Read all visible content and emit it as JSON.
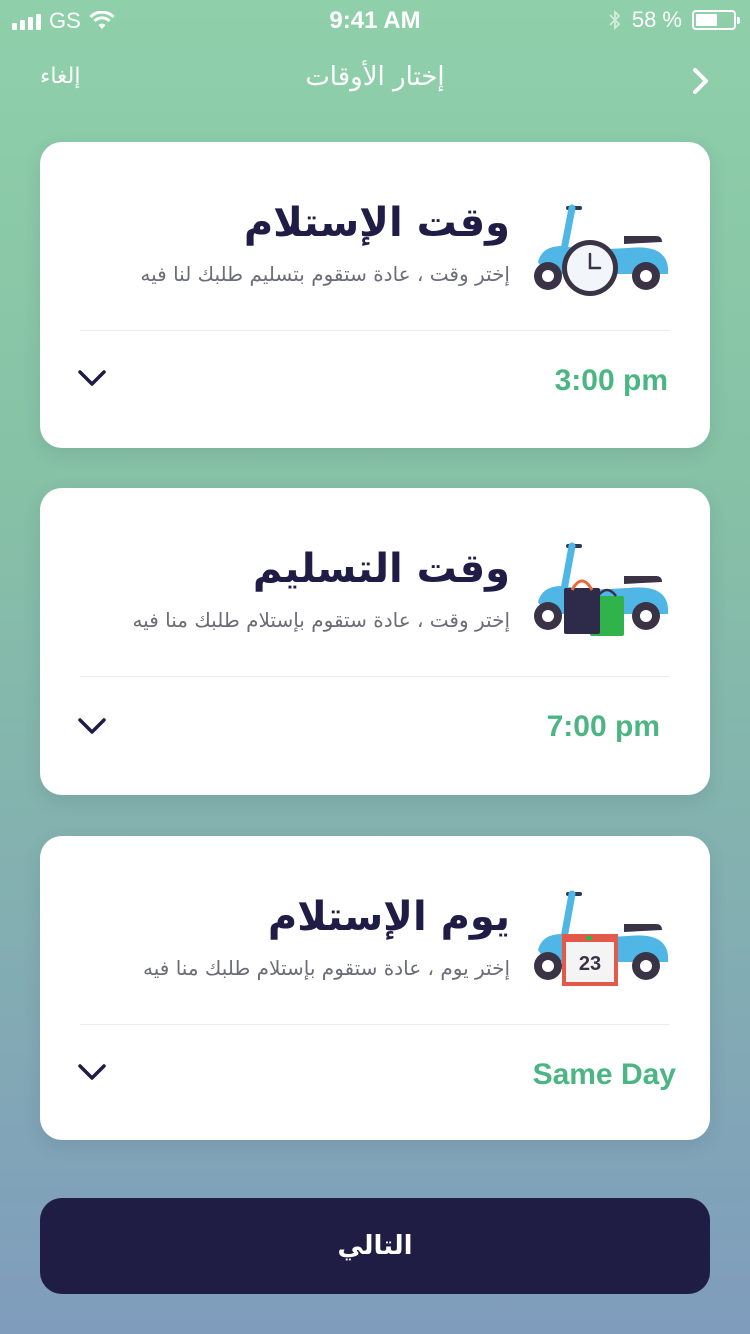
{
  "status_bar": {
    "carrier": "GS",
    "time": "9:41 AM",
    "battery": "58 %",
    "battery_level": 0.58
  },
  "nav": {
    "cancel_label": "إلغاء",
    "title": "إختار الأوقات",
    "back_icon": "chevron-right-icon"
  },
  "cards": [
    {
      "title": "وقت الإستلام",
      "subtitle": "إختر وقت ، عادة ستقوم بتسليم طلبك لنا فيه",
      "value": "3:00 pm",
      "illustration": "scooter-clock-illustration"
    },
    {
      "title": "وقت التسليم",
      "subtitle": "إختر وقت ، عادة ستقوم بإستلام طلبك منا فيه",
      "value": "7:00 pm",
      "illustration": "scooter-bags-illustration"
    },
    {
      "title": "يوم الإستلام",
      "subtitle": "إختر يوم ، عادة ستقوم بإستلام طلبك منا فيه",
      "value": "Same Day",
      "illustration": "scooter-calendar-illustration",
      "calendar_day": "23"
    }
  ],
  "next_button": {
    "label": "التالي"
  },
  "colors": {
    "accent_green": "#4bb583",
    "navy": "#201d45",
    "scooter_blue": "#4fb6e6"
  }
}
